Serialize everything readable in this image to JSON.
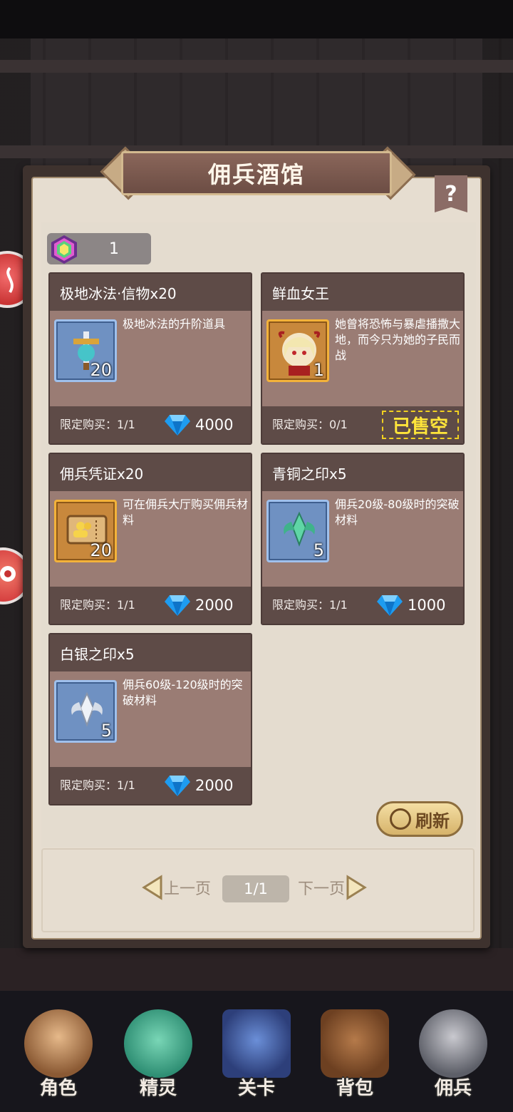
{
  "window": {
    "title": "佣兵酒馆"
  },
  "help": {
    "label": "?"
  },
  "currency": {
    "icon": "rainbow-gem-icon",
    "value": "1"
  },
  "shop_items": [
    {
      "name": "极地冰法·信物x20",
      "desc": "极地冰法的升阶道具",
      "qty": "20",
      "frame": "blue",
      "icon": "sword-emblem-icon",
      "limit": "限定购买：1/1",
      "price": "4000",
      "sold_out": false
    },
    {
      "name": "鲜血女王",
      "desc": "她曾将恐怖与暴虐播撒大地，而今只为她的子民而战",
      "qty": "1",
      "frame": "gold",
      "icon": "queen-portrait-icon",
      "limit": "限定购买：0/1",
      "price": "",
      "sold_out": true,
      "sold_out_label": "已售空"
    },
    {
      "name": "佣兵凭证x20",
      "desc": "可在佣兵大厅购买佣兵材料",
      "qty": "20",
      "frame": "gold",
      "icon": "ticket-icon",
      "limit": "限定购买：1/1",
      "price": "2000",
      "sold_out": false
    },
    {
      "name": "青铜之印x5",
      "desc": "佣兵20级-80级时的突破材料",
      "qty": "5",
      "frame": "blue",
      "icon": "green-seal-icon",
      "limit": "限定购买：1/1",
      "price": "1000",
      "sold_out": false
    },
    {
      "name": "白银之印x5",
      "desc": "佣兵60级-120级时的突破材料",
      "qty": "5",
      "frame": "blue",
      "icon": "silver-seal-icon",
      "limit": "限定购买：1/1",
      "price": "2000",
      "sold_out": false
    }
  ],
  "refresh": {
    "label": "刷新"
  },
  "pager": {
    "prev": "上一页",
    "current": "1/1",
    "next": "下一页"
  },
  "nav": [
    {
      "label": "角色",
      "icon": "character-icon"
    },
    {
      "label": "精灵",
      "icon": "spirit-icon"
    },
    {
      "label": "关卡",
      "icon": "stage-icon"
    },
    {
      "label": "背包",
      "icon": "backpack-icon"
    },
    {
      "label": "佣兵",
      "icon": "mercenary-icon"
    }
  ],
  "colors": {
    "diamond": "#1e9cf0",
    "sold_out": "#ffe53a",
    "card_bg": "#9a7c74",
    "card_header": "#5e4b47"
  }
}
